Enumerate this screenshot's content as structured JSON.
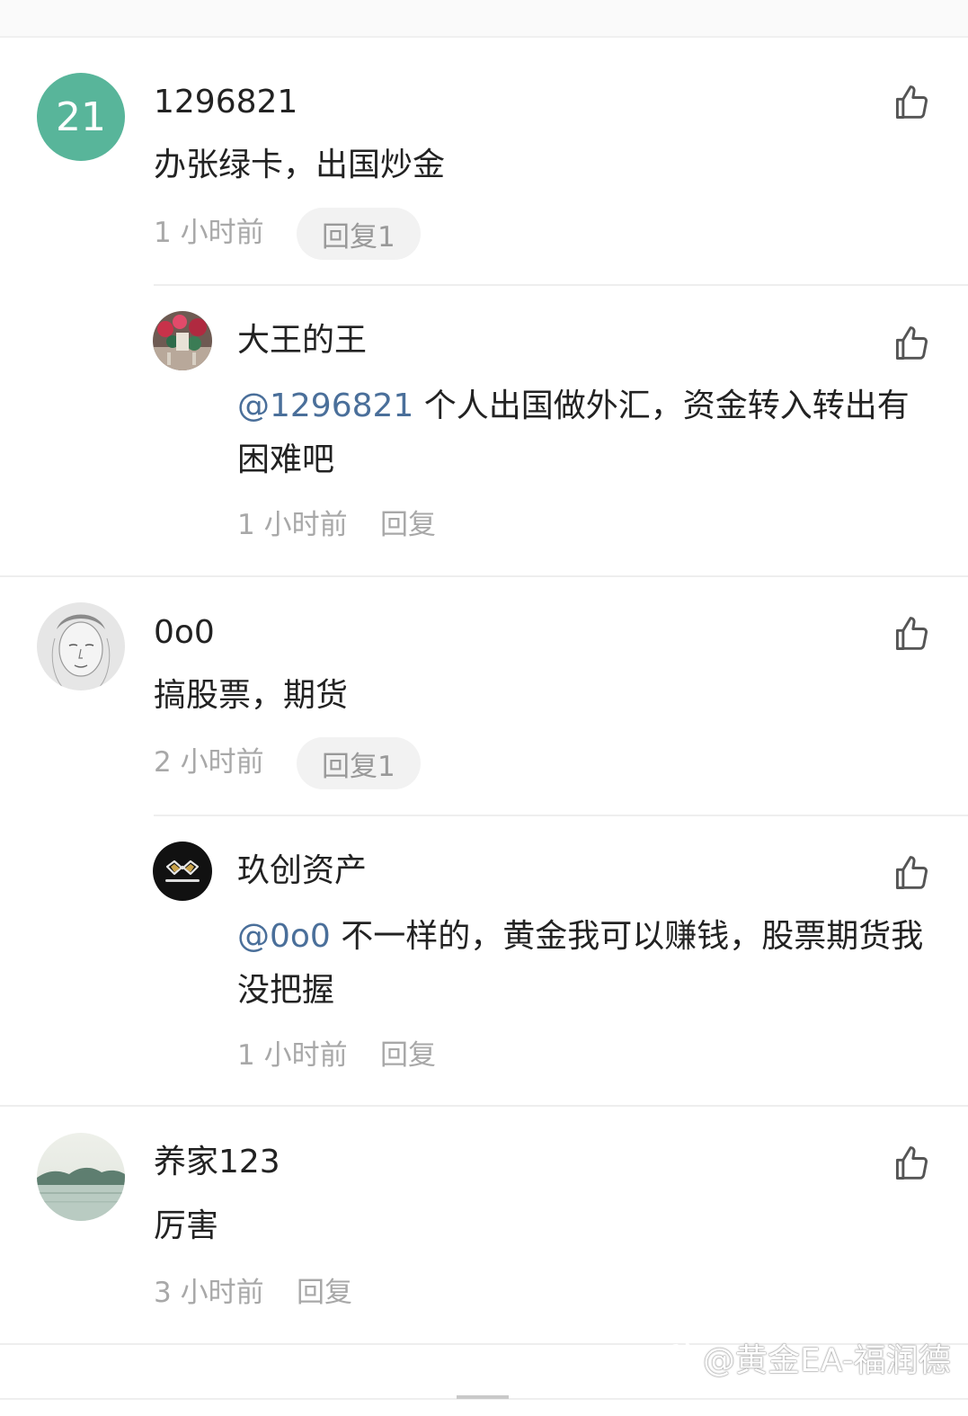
{
  "comments": [
    {
      "avatar_text": "21",
      "username": "1296821",
      "text": "办张绿卡，出国炒金",
      "time": "1 小时前",
      "reply_label": "回复1",
      "reply": {
        "username": "大王的王",
        "mention": "@1296821",
        "text": " 个人出国做外汇，资金转入转出有困难吧",
        "time": "1 小时前",
        "reply_label": "回复"
      }
    },
    {
      "username": "0o0",
      "text": "搞股票，期货",
      "time": "2 小时前",
      "reply_label": "回复1",
      "reply": {
        "username": "玖创资产",
        "mention": "@0o0",
        "text": " 不一样的，黄金我可以赚钱，股票期货我没把握",
        "time": "1 小时前",
        "reply_label": "回复"
      }
    },
    {
      "username": "养家123",
      "text": "厉害",
      "time": "3 小时前",
      "reply_label": "回复"
    }
  ],
  "watermark": "@黄金EA-福润德",
  "colors": {
    "avatar_green": "#58b59a",
    "mention_blue": "#4a6f9a",
    "meta_gray": "#a8a8a8"
  }
}
